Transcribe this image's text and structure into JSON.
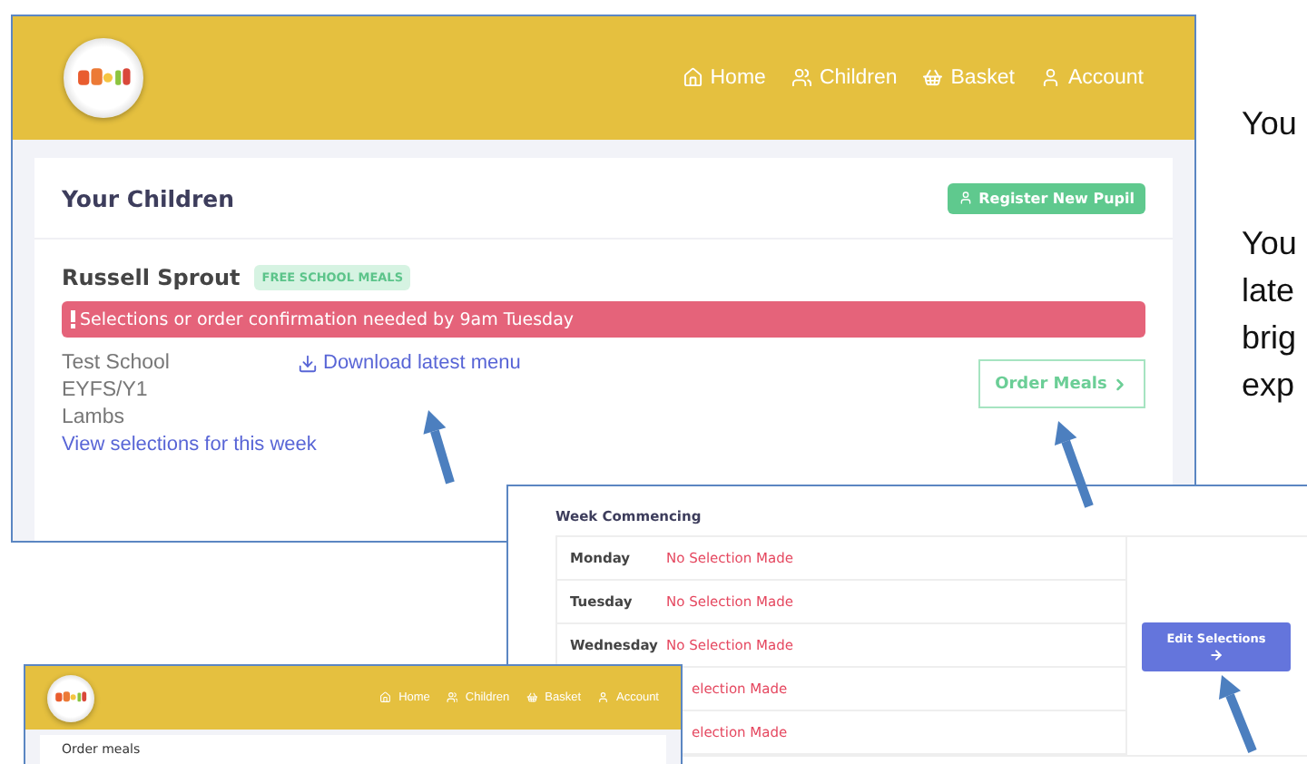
{
  "children_screen": {
    "nav": [
      {
        "label": "Home"
      },
      {
        "label": "Children"
      },
      {
        "label": "Basket"
      },
      {
        "label": "Account"
      }
    ],
    "title": "Your Children",
    "register_button": "Register New Pupil",
    "child": {
      "name": "Russell Sprout",
      "badge": "FREE SCHOOL MEALS",
      "alert": "Selections or order confirmation needed by 9am Tuesday",
      "details": [
        "Test School",
        "EYFS/Y1",
        "Lambs"
      ],
      "download_link": "Download latest menu",
      "view_link": "View selections for this week",
      "order_button": "Order Meals"
    }
  },
  "document_text": [
    {
      "lines": [
        "You"
      ]
    },
    {
      "lines": [
        "You",
        "late",
        "brig",
        "exp"
      ]
    }
  ],
  "week_screen": {
    "title": "Week Commencing",
    "rows": [
      {
        "kind": "full",
        "day": "Monday",
        "status": "No Selection Made"
      },
      {
        "kind": "full",
        "day": "Tuesday",
        "status": "No Selection Made"
      },
      {
        "kind": "full",
        "day": "Wednesday",
        "status": "No Selection Made"
      },
      {
        "kind": "partial",
        "status": "election Made"
      },
      {
        "kind": "partial",
        "status": "election Made"
      }
    ],
    "edit_button": "Edit Selections"
  },
  "order_screen": {
    "nav": [
      {
        "label": "Home"
      },
      {
        "label": "Children"
      },
      {
        "label": "Basket"
      },
      {
        "label": "Account"
      }
    ],
    "title": "Order meals"
  }
}
